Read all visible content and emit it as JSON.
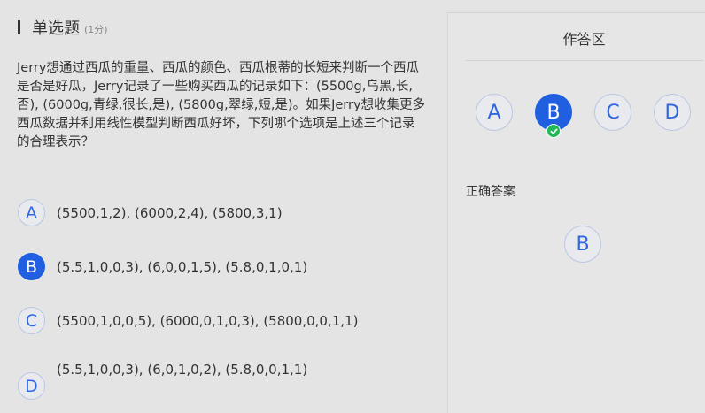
{
  "question": {
    "type_label": "单选题",
    "score_label": "(1分)",
    "text": "Jerry想通过西瓜的重量、西瓜的颜色、西瓜根蒂的长短来判断一个西瓜是否是好瓜，Jerry记录了一些购买西瓜的记录如下：(5500g,乌黑,长,否), (6000g,青绿,很长,是), (5800g,翠绿,短,是)。如果Jerry想收集更多西瓜数据并利用线性模型判断西瓜好坏，下列哪个选项是上述三个记录的合理表示？",
    "options": [
      {
        "letter": "A",
        "text": "(5500,1,2), (6000,2,4), (5800,3,1)",
        "selected": false
      },
      {
        "letter": "B",
        "text": "(5.5,1,0,0,3), (6,0,0,1,5), (5.8,0,1,0,1)",
        "selected": true
      },
      {
        "letter": "C",
        "text": "(5500,1,0,0,5), (6000,0,1,0,3), (5800,0,0,1,1)",
        "selected": false
      },
      {
        "letter": "D",
        "text": "(5.5,1,0,0,3), (6,0,1,0,2), (5.8,0,0,1,1)",
        "selected": false
      }
    ]
  },
  "answer_panel": {
    "title": "作答区",
    "choices": [
      "A",
      "B",
      "C",
      "D"
    ],
    "selected": "B",
    "correct_label": "正确答案",
    "correct_answer": "B"
  },
  "colors": {
    "accent": "#1f5fe0",
    "accent_text": "#2f67e0",
    "success": "#22b85a",
    "background": "#e4e4e4"
  }
}
